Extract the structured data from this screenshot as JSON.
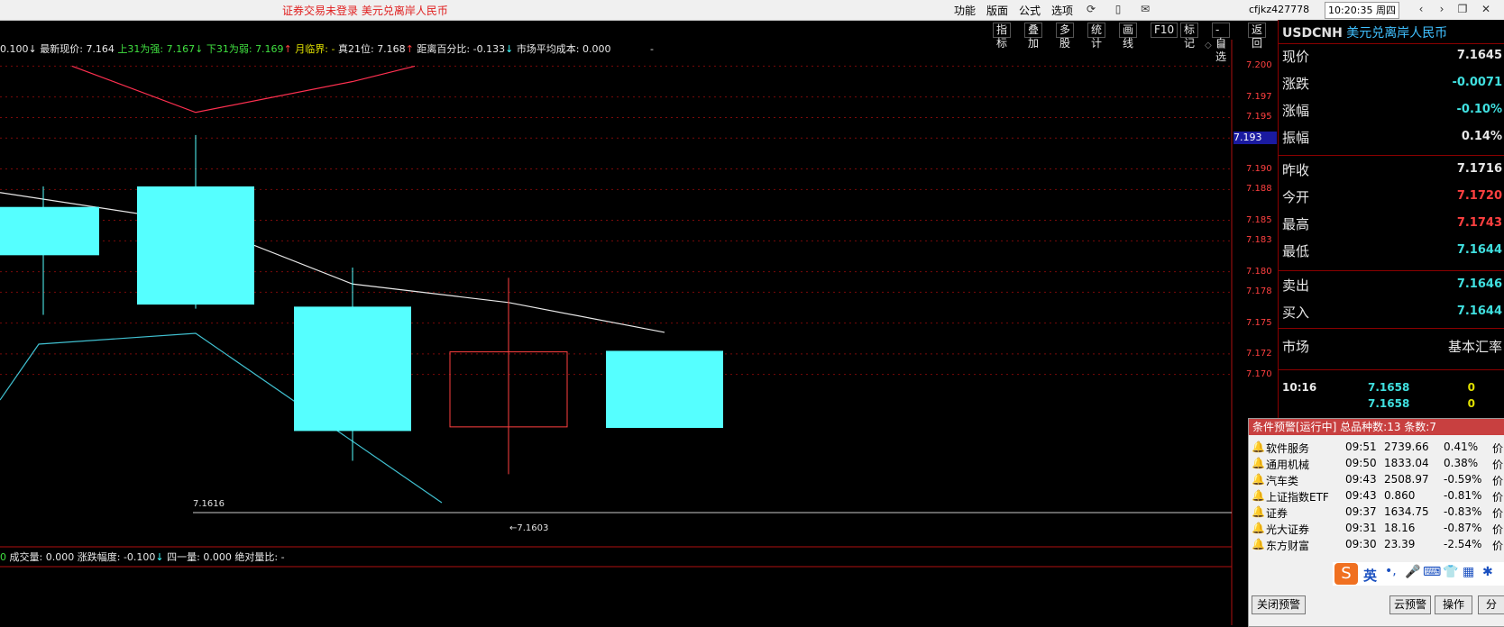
{
  "app": {
    "title": "证券交易未登录  美元兑离岸人民币"
  },
  "menu": [
    "功能",
    "版面",
    "公式",
    "选项"
  ],
  "account": "cfjkz427778",
  "clock": "10:20:35 周四",
  "tools": [
    "指标",
    "叠加",
    "多股",
    "统计",
    "画线",
    "F10",
    "标记",
    "-自选",
    "返回"
  ],
  "info_bar": {
    "p1": "0.100",
    "latest_label": "最新现价:",
    "latest": "7.164",
    "up31_label": "上31为强:",
    "up31": "7.167",
    "down31_label": "下31为弱:",
    "down31": "7.169",
    "month_label": "月临界:",
    "month": "-",
    "true21_label": "真21位:",
    "true21": "7.168",
    "dist_label": "距离百分比:",
    "dist": "-0.133",
    "cost_label": "市场平均成本:",
    "cost": "0.000",
    "dash": "-"
  },
  "volume_bar": {
    "p0": "0",
    "vol_label": "成交量:",
    "vol": "0.000",
    "range_label": "涨跌幅度:",
    "range": "-0.100",
    "four_label": "四一量:",
    "four": "0.000",
    "abs_label": "绝对量比:",
    "abs": "-"
  },
  "y_axis": [
    "7.200",
    "7.197",
    "7.195",
    "7.193",
    "7.190",
    "7.188",
    "7.185",
    "7.183",
    "7.180",
    "7.178",
    "7.175",
    "7.172",
    "7.170"
  ],
  "y_cursor": "7.193",
  "annotations": {
    "hline_label": "7.1616",
    "low_label": "←7.1603"
  },
  "chart_data": {
    "type": "candlestick",
    "ylim": [
      7.157,
      7.201
    ],
    "candles": [
      {
        "open": 7.1863,
        "close": 7.1816,
        "high": 7.1883,
        "low": 7.1758,
        "color": "cyan",
        "partial": true
      },
      {
        "open": 7.1883,
        "close": 7.1768,
        "high": 7.1933,
        "low": 7.1764,
        "color": "cyan"
      },
      {
        "open": 7.1766,
        "close": 7.1645,
        "high": 7.1804,
        "low": 7.1616,
        "color": "cyan"
      },
      {
        "open": 7.1649,
        "close": 7.1722,
        "high": 7.1794,
        "low": 7.1603,
        "color": "red-hollow"
      },
      {
        "open": 7.1723,
        "close": 7.1648,
        "high": 7.1723,
        "low": 7.1648,
        "color": "cyan"
      }
    ],
    "ma_white": [
      7.1877,
      7.1848,
      7.1788,
      7.177,
      7.1741
    ],
    "red_line": [
      7.2,
      7.1955,
      7.1985,
      7.2
    ],
    "cyan_line_desc": true
  },
  "quote": {
    "symbol": "USDCNH",
    "name": "美元兑离岸人民币",
    "rows1": [
      {
        "label": "现价",
        "value": "7.1645",
        "color": "#e8e8e8"
      },
      {
        "label": "涨跌",
        "value": "-0.0071",
        "color": "#40e0e0"
      },
      {
        "label": "涨幅",
        "value": "-0.10%",
        "color": "#40e0e0"
      },
      {
        "label": "振幅",
        "value": "0.14%",
        "color": "#e8e8e8"
      }
    ],
    "rows2": [
      {
        "label": "昨收",
        "value": "7.1716",
        "color": "#e8e8e8"
      },
      {
        "label": "今开",
        "value": "7.1720",
        "color": "#ff4040"
      },
      {
        "label": "最高",
        "value": "7.1743",
        "color": "#ff4040"
      },
      {
        "label": "最低",
        "value": "7.1644",
        "color": "#40e0e0"
      }
    ],
    "rows3": [
      {
        "label": "卖出",
        "value": "7.1646",
        "color": "#40e0e0"
      },
      {
        "label": "买入",
        "value": "7.1644",
        "color": "#40e0e0"
      }
    ],
    "market_label": "市场",
    "market_value": "基本汇率",
    "ticks": [
      {
        "time": "10:16",
        "price": "7.1658",
        "vol": "0"
      },
      {
        "time": "",
        "price": "7.1658",
        "vol": "0"
      }
    ]
  },
  "alert": {
    "title": "条件预警[运行中] 总品种数:13 条数:7",
    "rows": [
      {
        "name": "软件服务",
        "time": "09:51",
        "price": "2739.66",
        "pct": "0.41%",
        "tail": "价",
        "bell": "red"
      },
      {
        "name": "通用机械",
        "time": "09:50",
        "price": "1833.04",
        "pct": "0.38%",
        "tail": "价",
        "bell": "red"
      },
      {
        "name": "汽车类",
        "time": "09:43",
        "price": "2508.97",
        "pct": "-0.59%",
        "tail": "价",
        "bell": "green"
      },
      {
        "name": "上证指数ETF",
        "time": "09:43",
        "price": "0.860",
        "pct": "-0.81%",
        "tail": "价",
        "bell": "green"
      },
      {
        "name": "证券",
        "time": "09:37",
        "price": "1634.75",
        "pct": "-0.83%",
        "tail": "价",
        "bell": "green"
      },
      {
        "name": "光大证券",
        "time": "09:31",
        "price": "18.16",
        "pct": "-0.87%",
        "tail": "价",
        "bell": "green"
      },
      {
        "name": "东方财富",
        "time": "09:30",
        "price": "23.39",
        "pct": "-2.54%",
        "tail": "价",
        "bell": "green"
      }
    ],
    "ime_label": "英",
    "close_btn": "关闭预警",
    "cloud_btn": "云预警",
    "op_btn": "操作",
    "tail_btn": "分"
  }
}
